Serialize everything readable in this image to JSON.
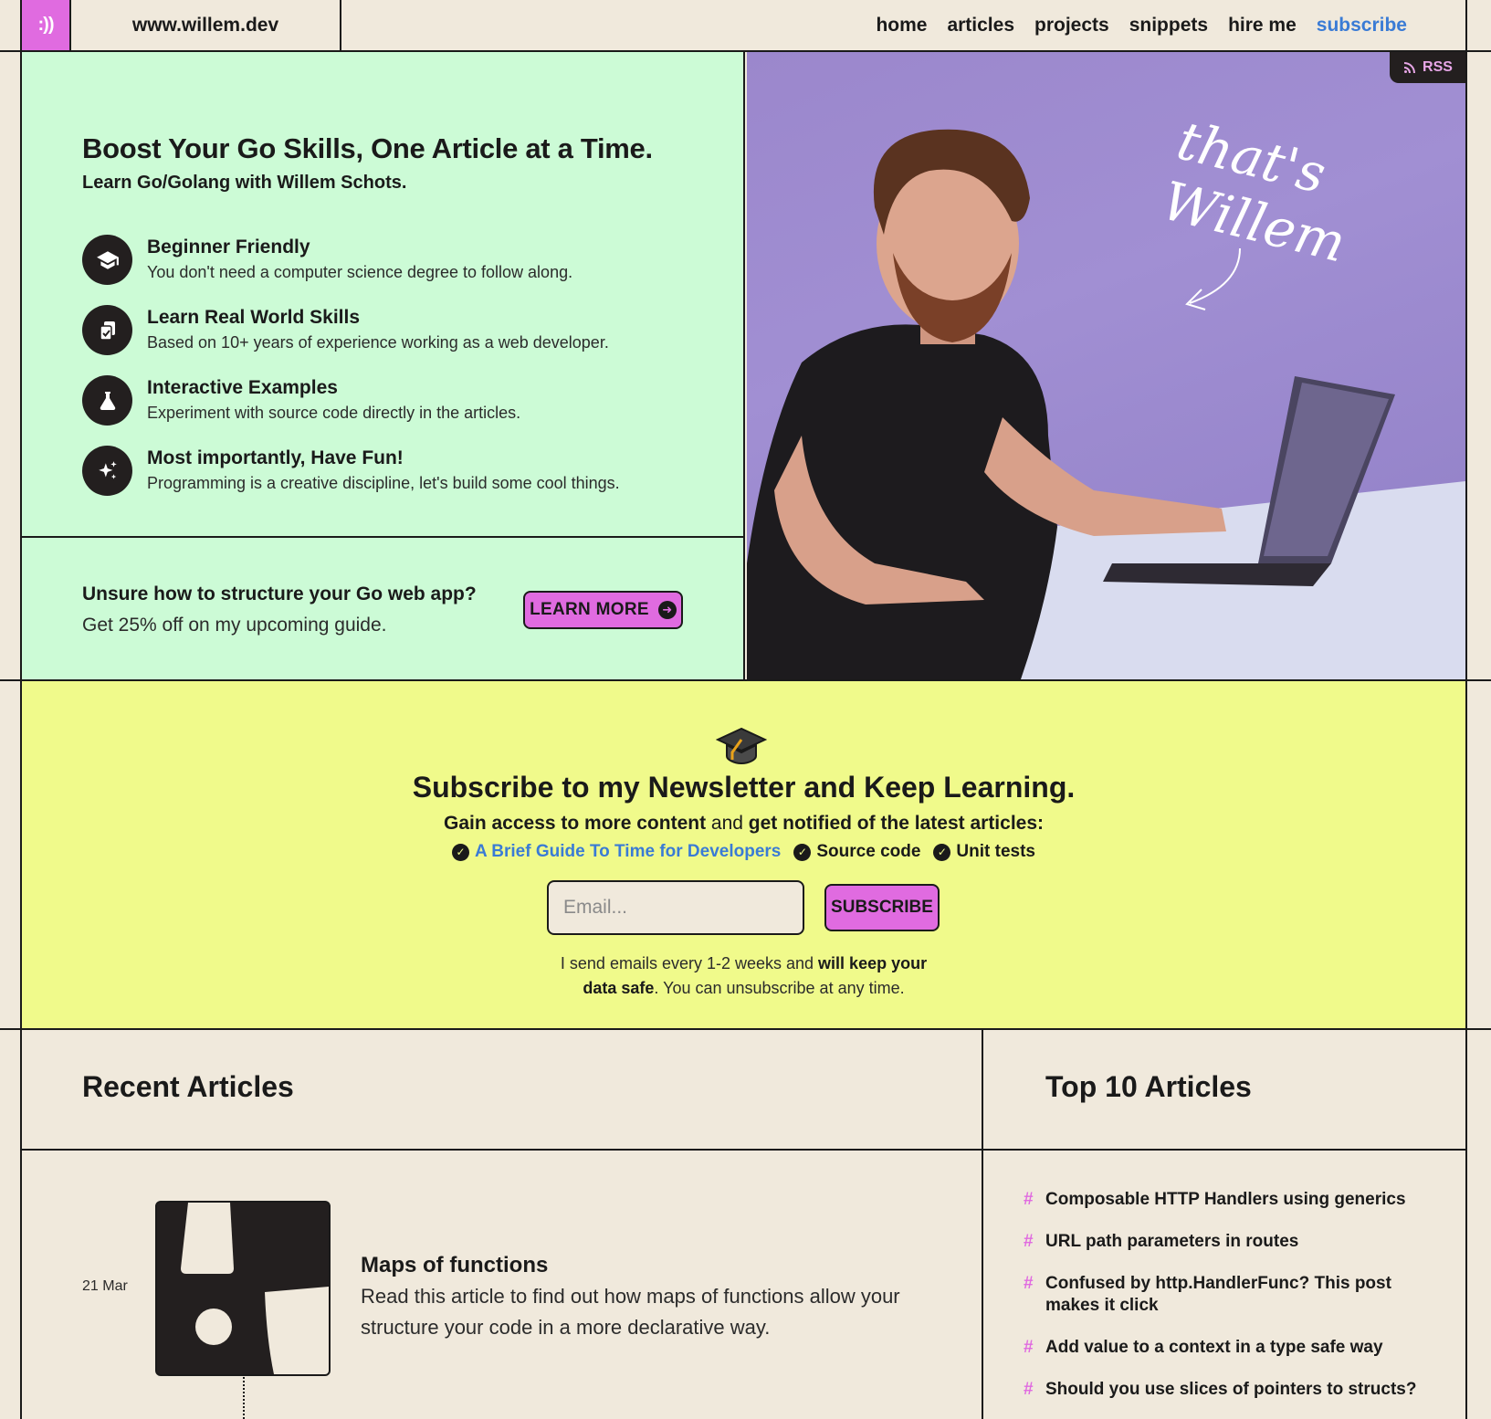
{
  "header": {
    "logo_glyph": ":))",
    "site_name": "www.willem.dev",
    "nav": [
      {
        "label": "home"
      },
      {
        "label": "articles"
      },
      {
        "label": "projects"
      },
      {
        "label": "snippets"
      },
      {
        "label": "hire me"
      },
      {
        "label": "subscribe",
        "accent": "#3a7bd5"
      }
    ]
  },
  "hero": {
    "title": "Boost Your Go Skills, One Article at a Time.",
    "subtitle": "Learn Go/Golang with Willem Schots.",
    "features": [
      {
        "icon": "graduation-cap-icon",
        "title": "Beginner Friendly",
        "desc": "You don't need a computer science degree to follow along."
      },
      {
        "icon": "copy-check-icon",
        "title": "Learn Real World Skills",
        "desc": "Based on 10+ years of experience working as a web developer."
      },
      {
        "icon": "flask-icon",
        "title": "Interactive Examples",
        "desc": "Experiment with source code directly in the articles."
      },
      {
        "icon": "sparkles-icon",
        "title": "Most importantly, Have Fun!",
        "desc": "Programming is a creative discipline, let's build some cool things."
      }
    ],
    "promo_question": "Unsure how to structure your Go web app?",
    "promo_desc": "Get 25% off on my upcoming guide.",
    "learn_more": "LEARN MORE",
    "rss": "RSS",
    "signature": "that's Willem",
    "bg_color": "#ccfbd6"
  },
  "newsletter": {
    "title": "Subscribe to my Newsletter and Keep Learning.",
    "sub_bold1": "Gain access to more content",
    "sub_and": " and ",
    "sub_bold2": "get notified of the latest articles:",
    "perks": [
      {
        "label": "A Brief Guide To Time for Developers",
        "link": true
      },
      {
        "label": "Source code",
        "link": false
      },
      {
        "label": "Unit tests",
        "link": false
      }
    ],
    "email_placeholder": "Email...",
    "subscribe_label": "SUBSCRIBE",
    "note_1": "I send emails every 1-2 weeks and ",
    "note_bold_1": "will keep your",
    "note_bold_2": "data safe",
    "note_2": ". You can unsubscribe at any time.",
    "bg_color": "#f0fa8b"
  },
  "recent": {
    "heading": "Recent Articles",
    "articles": [
      {
        "date": "21 Mar",
        "title": "Maps of functions",
        "desc": "Read this article to find out how maps of functions allow your structure your code in a more declarative way."
      }
    ]
  },
  "top10": {
    "heading": "Top 10 Articles",
    "items": [
      "Composable HTTP Handlers using generics",
      "URL path parameters in routes",
      "Confused by http.HandlerFunc? This post makes it click",
      "Add value to a context in a type safe way",
      "Should you use slices of pointers to structs?"
    ]
  },
  "colors": {
    "accent_pink": "#e06be0",
    "link_blue": "#3a7bd5",
    "page_bg": "#f0e9dc"
  }
}
